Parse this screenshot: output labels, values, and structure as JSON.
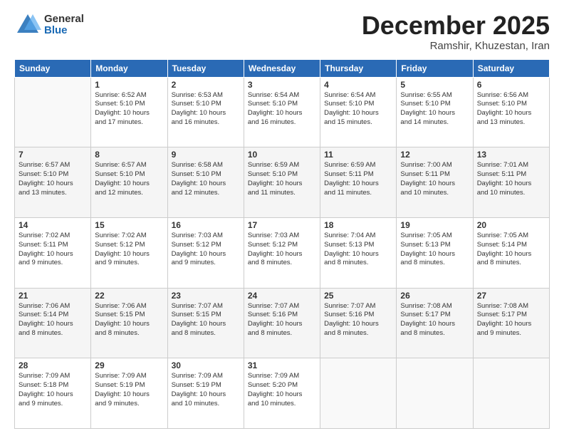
{
  "logo": {
    "general": "General",
    "blue": "Blue"
  },
  "header": {
    "month": "December 2025",
    "location": "Ramshir, Khuzestan, Iran"
  },
  "weekdays": [
    "Sunday",
    "Monday",
    "Tuesday",
    "Wednesday",
    "Thursday",
    "Friday",
    "Saturday"
  ],
  "weeks": [
    [
      {
        "day": "",
        "info": ""
      },
      {
        "day": "1",
        "info": "Sunrise: 6:52 AM\nSunset: 5:10 PM\nDaylight: 10 hours\nand 17 minutes."
      },
      {
        "day": "2",
        "info": "Sunrise: 6:53 AM\nSunset: 5:10 PM\nDaylight: 10 hours\nand 16 minutes."
      },
      {
        "day": "3",
        "info": "Sunrise: 6:54 AM\nSunset: 5:10 PM\nDaylight: 10 hours\nand 16 minutes."
      },
      {
        "day": "4",
        "info": "Sunrise: 6:54 AM\nSunset: 5:10 PM\nDaylight: 10 hours\nand 15 minutes."
      },
      {
        "day": "5",
        "info": "Sunrise: 6:55 AM\nSunset: 5:10 PM\nDaylight: 10 hours\nand 14 minutes."
      },
      {
        "day": "6",
        "info": "Sunrise: 6:56 AM\nSunset: 5:10 PM\nDaylight: 10 hours\nand 13 minutes."
      }
    ],
    [
      {
        "day": "7",
        "info": "Sunrise: 6:57 AM\nSunset: 5:10 PM\nDaylight: 10 hours\nand 13 minutes."
      },
      {
        "day": "8",
        "info": "Sunrise: 6:57 AM\nSunset: 5:10 PM\nDaylight: 10 hours\nand 12 minutes."
      },
      {
        "day": "9",
        "info": "Sunrise: 6:58 AM\nSunset: 5:10 PM\nDaylight: 10 hours\nand 12 minutes."
      },
      {
        "day": "10",
        "info": "Sunrise: 6:59 AM\nSunset: 5:10 PM\nDaylight: 10 hours\nand 11 minutes."
      },
      {
        "day": "11",
        "info": "Sunrise: 6:59 AM\nSunset: 5:11 PM\nDaylight: 10 hours\nand 11 minutes."
      },
      {
        "day": "12",
        "info": "Sunrise: 7:00 AM\nSunset: 5:11 PM\nDaylight: 10 hours\nand 10 minutes."
      },
      {
        "day": "13",
        "info": "Sunrise: 7:01 AM\nSunset: 5:11 PM\nDaylight: 10 hours\nand 10 minutes."
      }
    ],
    [
      {
        "day": "14",
        "info": "Sunrise: 7:02 AM\nSunset: 5:11 PM\nDaylight: 10 hours\nand 9 minutes."
      },
      {
        "day": "15",
        "info": "Sunrise: 7:02 AM\nSunset: 5:12 PM\nDaylight: 10 hours\nand 9 minutes."
      },
      {
        "day": "16",
        "info": "Sunrise: 7:03 AM\nSunset: 5:12 PM\nDaylight: 10 hours\nand 9 minutes."
      },
      {
        "day": "17",
        "info": "Sunrise: 7:03 AM\nSunset: 5:12 PM\nDaylight: 10 hours\nand 8 minutes."
      },
      {
        "day": "18",
        "info": "Sunrise: 7:04 AM\nSunset: 5:13 PM\nDaylight: 10 hours\nand 8 minutes."
      },
      {
        "day": "19",
        "info": "Sunrise: 7:05 AM\nSunset: 5:13 PM\nDaylight: 10 hours\nand 8 minutes."
      },
      {
        "day": "20",
        "info": "Sunrise: 7:05 AM\nSunset: 5:14 PM\nDaylight: 10 hours\nand 8 minutes."
      }
    ],
    [
      {
        "day": "21",
        "info": "Sunrise: 7:06 AM\nSunset: 5:14 PM\nDaylight: 10 hours\nand 8 minutes."
      },
      {
        "day": "22",
        "info": "Sunrise: 7:06 AM\nSunset: 5:15 PM\nDaylight: 10 hours\nand 8 minutes."
      },
      {
        "day": "23",
        "info": "Sunrise: 7:07 AM\nSunset: 5:15 PM\nDaylight: 10 hours\nand 8 minutes."
      },
      {
        "day": "24",
        "info": "Sunrise: 7:07 AM\nSunset: 5:16 PM\nDaylight: 10 hours\nand 8 minutes."
      },
      {
        "day": "25",
        "info": "Sunrise: 7:07 AM\nSunset: 5:16 PM\nDaylight: 10 hours\nand 8 minutes."
      },
      {
        "day": "26",
        "info": "Sunrise: 7:08 AM\nSunset: 5:17 PM\nDaylight: 10 hours\nand 8 minutes."
      },
      {
        "day": "27",
        "info": "Sunrise: 7:08 AM\nSunset: 5:17 PM\nDaylight: 10 hours\nand 9 minutes."
      }
    ],
    [
      {
        "day": "28",
        "info": "Sunrise: 7:09 AM\nSunset: 5:18 PM\nDaylight: 10 hours\nand 9 minutes."
      },
      {
        "day": "29",
        "info": "Sunrise: 7:09 AM\nSunset: 5:19 PM\nDaylight: 10 hours\nand 9 minutes."
      },
      {
        "day": "30",
        "info": "Sunrise: 7:09 AM\nSunset: 5:19 PM\nDaylight: 10 hours\nand 10 minutes."
      },
      {
        "day": "31",
        "info": "Sunrise: 7:09 AM\nSunset: 5:20 PM\nDaylight: 10 hours\nand 10 minutes."
      },
      {
        "day": "",
        "info": ""
      },
      {
        "day": "",
        "info": ""
      },
      {
        "day": "",
        "info": ""
      }
    ]
  ]
}
